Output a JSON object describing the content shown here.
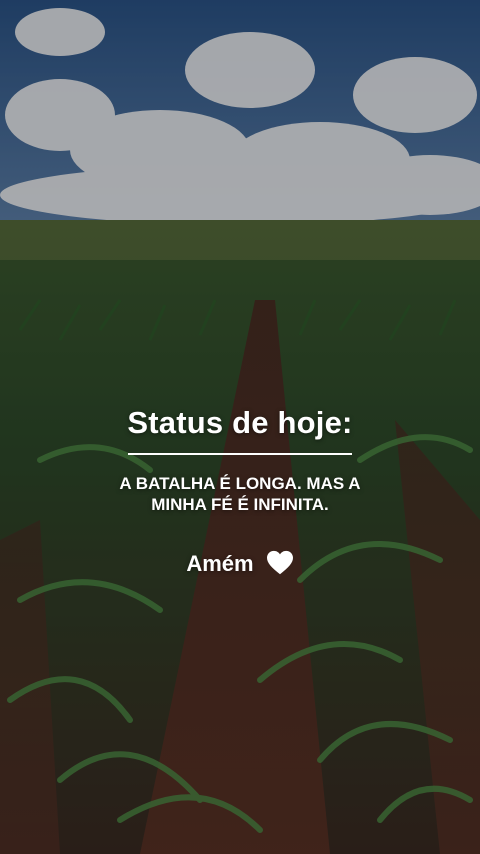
{
  "status": {
    "title": "Status de hoje:",
    "message": "A BATALHA É LONGA. MAS A MINHA FÉ É INFINITA.",
    "closing": "Amém",
    "closing_icon": "white-heart-icon"
  },
  "colors": {
    "text": "#ffffff",
    "sky": "#2f5a8c",
    "foliage": "#3f6a3b",
    "soil": "#5a2e22"
  }
}
